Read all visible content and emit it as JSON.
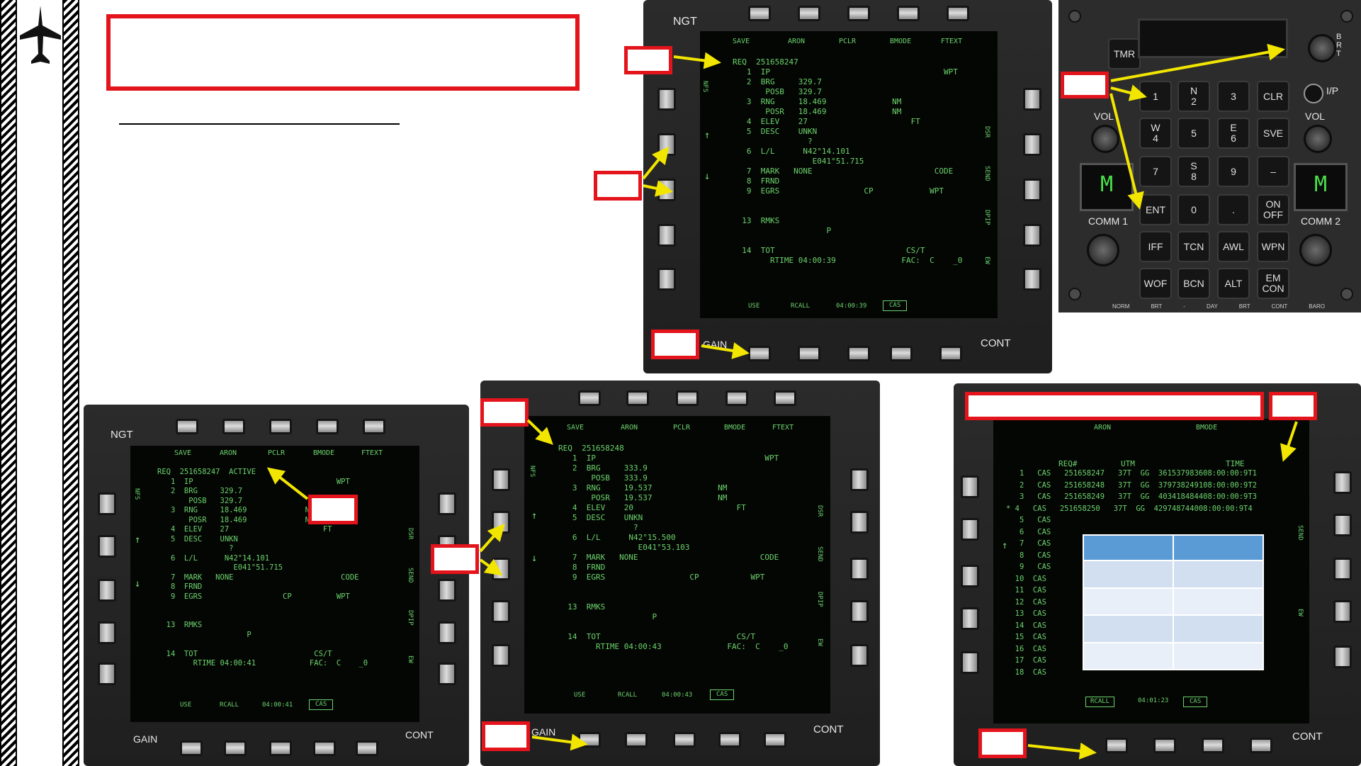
{
  "slide": {
    "colors": {
      "callout_red": "#e3141b",
      "arrow_yellow": "#f2e600",
      "mfd_green": "#6cd36c",
      "table_header": "#5b9bd5",
      "table_row_a": "#d2dff0",
      "table_row_b": "#e9eff8"
    },
    "sidebar_icon": "jet-icon"
  },
  "mfd_top": {
    "top_labels": [
      "SAVE",
      "ARON",
      "PCLR",
      "BMODE",
      "FTEXT"
    ],
    "top_left_label": "NGT",
    "bottom_left_label": "GAIN",
    "bottom_right_label": "CONT",
    "side_nfs": "NFS",
    "right_side": [
      "DSR",
      "SEND",
      "DPIP",
      "EW"
    ],
    "lines": [
      "REQ  251658247",
      "   1  IP                                     WPT",
      "   2  BRG     329.7",
      "       POSB   329.7",
      "   3  RNG     18.469              NM",
      "       POSR   18.469              NM",
      "   4  ELEV    27                      FT",
      "   5  DESC    UNKN",
      "                ?",
      "   6  L/L      N42°14.101",
      "                 E041°51.715",
      "   7  MARK   NONE                          CODE",
      "   8  FRND",
      "   9  EGRS                  CP            WPT",
      "",
      "  13  RMKS",
      "                    P",
      "",
      "  14  TOT                            CS/T",
      "        RTIME 04:00:39              FAC:  C    _0"
    ],
    "bottom_row": [
      "USE",
      "RCALL",
      "04:00:39",
      "CAS"
    ]
  },
  "ufc": {
    "tmr": "TMR",
    "brt": "BRT",
    "ip": "I/P",
    "vol_left": "VOL",
    "vol_right": "VOL",
    "comm1": "COMM  1",
    "comm2": "COMM  2",
    "comm_display": "M",
    "keys": [
      "1",
      "N\n2",
      "3",
      "CLR",
      "W\n4",
      "5",
      "E\n6",
      "SVE",
      "7",
      "S\n8",
      "9",
      "–",
      "ENT",
      "0",
      ".",
      "ON\nOFF",
      "IFF",
      "TCN",
      "AWL",
      "WPN",
      "WOF",
      "BCN",
      "ALT",
      "EM\nCON"
    ],
    "bottom_strip": [
      "NORM",
      "BRT",
      "-",
      "DAY",
      "BRT",
      "CONT",
      "BARO"
    ]
  },
  "mfd_bl": {
    "top_left_label": "NGT",
    "bottom_left_label": "GAIN",
    "bottom_right_label": "CONT",
    "top_labels": [
      "SAVE",
      "ARON",
      "PCLR",
      "BMODE",
      "FTEXT"
    ],
    "side_nfs": "NFS",
    "right_side": [
      "DSR",
      "SEND",
      "DPIP",
      "EW"
    ],
    "lines": [
      "REQ  251658247  ACTIVE",
      "   1  IP                                WPT",
      "   2  BRG     329.7",
      "       POSB   329.7",
      "   3  RNG     18.469             NM",
      "       POSR   18.469             NM",
      "   4  ELEV    27                     FT",
      "   5  DESC    UNKN",
      "                ?",
      "   6  L/L      N42°14.101",
      "                 E041°51.715",
      "   7  MARK   NONE                        CODE",
      "   8  FRND",
      "   9  EGRS                  CP          WPT",
      "",
      "  13  RMKS",
      "                    P",
      "",
      "  14  TOT                          CS/T",
      "        RTIME 04:00:41            FAC:  C    _0"
    ],
    "bottom_row": [
      "USE",
      "RCALL",
      "04:00:41",
      "CAS"
    ]
  },
  "mfd_bm": {
    "bottom_left_label": "GAIN",
    "bottom_right_label": "CONT",
    "top_labels": [
      "SAVE",
      "ARON",
      "PCLR",
      "BMODE",
      "FTEXT"
    ],
    "side_nfs": "NFS",
    "right_side": [
      "DSR",
      "SEND",
      "DPIP",
      "EW"
    ],
    "lines": [
      "REQ  251658248",
      "   1  IP                                    WPT",
      "   2  BRG     333.9",
      "       POSB   333.9",
      "   3  RNG     19.537              NM",
      "       POSR   19.537              NM",
      "   4  ELEV    20                      FT",
      "   5  DESC    UNKN",
      "                ?",
      "   6  L/L      N42°15.500",
      "                 E041°53.103",
      "   7  MARK   NONE                          CODE",
      "   8  FRND",
      "   9  EGRS                  CP           WPT",
      "",
      "  13  RMKS",
      "                    P",
      "",
      "  14  TOT                             CS/T",
      "        RTIME 04:00:43              FAC:  C    _0"
    ],
    "bottom_row": [
      "USE",
      "RCALL",
      "04:00:43",
      "CAS"
    ]
  },
  "mfd_br": {
    "bottom_right_label": "CONT",
    "top_labels": [
      "ARON",
      "BMODE"
    ],
    "headers": [
      "REQ#",
      "UTM",
      "TIME"
    ],
    "rows": [
      "   1   CAS   251658247   37T  GG  361537983608:00:00:9T1",
      "   2   CAS   251658248   37T  GG  379738249108:00:00:9T2",
      "   3   CAS   251658249   37T  GG  403418484408:00:00:9T3",
      "* 4   CAS   251658250   37T  GG  429748744008:00:00:9T4",
      "   5   CAS",
      "   6   CAS",
      "   7   CAS",
      "   8   CAS",
      "   9   CAS",
      "  10  CAS",
      "  11  CAS",
      "  12  CAS",
      "  13  CAS",
      "  14  CAS",
      "  15  CAS",
      "  16  CAS",
      "  17  CAS",
      "  18  CAS"
    ],
    "right_side": [
      "SEND",
      "EW"
    ],
    "bottom_row": [
      "RCALL",
      "04:01:23",
      "CAS"
    ]
  }
}
